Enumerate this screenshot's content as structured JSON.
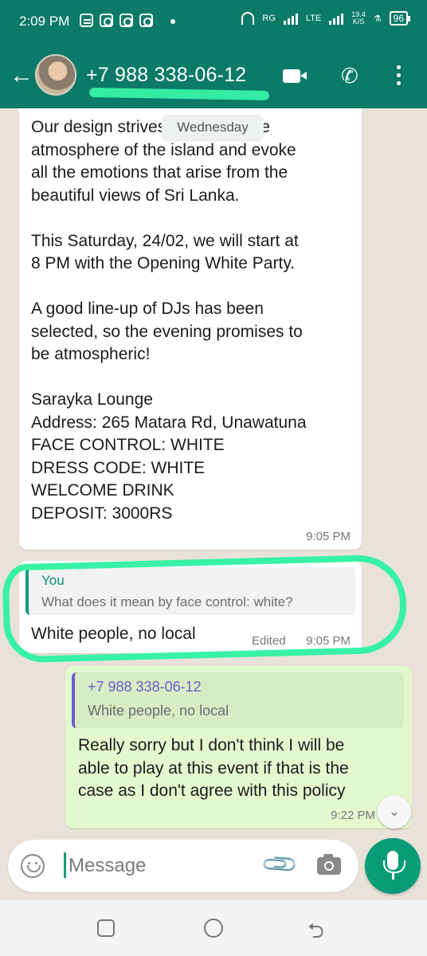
{
  "status_bar": {
    "time": "2:09 PM",
    "network": "RG",
    "lte": "LTE",
    "speed_value": "19.4",
    "speed_unit": "K/S",
    "battery": "96"
  },
  "header": {
    "contact_name": "+7 988 338-06-12",
    "icons": [
      "back-arrow-icon",
      "video-call-icon",
      "phone-icon",
      "more-vertical-icon"
    ]
  },
  "chat": {
    "date_chip": "Wednesday",
    "message1": {
      "paragraphs": [
        [
          "Our design strives to convey the",
          "atmosphere of the island and evoke",
          "all the emotions that arise from the",
          "beautiful views of Sri Lanka."
        ],
        [
          "This Saturday, 24/02, we will start at",
          "8 PM with the Opening White Party."
        ],
        [
          "A good line-up of DJs has been",
          "selected, so the evening promises to",
          "be atmospheric!"
        ],
        [
          "Sarayka Lounge",
          "Address: 265 Matara Rd, Unawatuna",
          "FACE CONTROL: WHITE",
          "DRESS CODE: WHITE",
          "WELCOME DRINK",
          "DEPOSIT: 3000RS"
        ]
      ],
      "time": "9:05 PM"
    },
    "message2": {
      "quote_author": "You",
      "quote_text": "What does it mean by face control: white?",
      "text": "White people, no local",
      "edited_label": "Edited",
      "time": "9:05 PM"
    },
    "message3": {
      "quote_author": "+7 988 338-06-12",
      "quote_text": "White people, no local",
      "lines": [
        "Really sorry but I don't think I will be",
        "able to play at this event if that is the",
        "case as I don't agree with this policy"
      ],
      "time": "9:22 PM"
    }
  },
  "composer": {
    "placeholder": "Message"
  },
  "colors": {
    "header": "#0b7a68",
    "highlight": "#37f2a6",
    "outgoing_bubble": "#e4f8cf",
    "accent": "#0a9c76"
  }
}
